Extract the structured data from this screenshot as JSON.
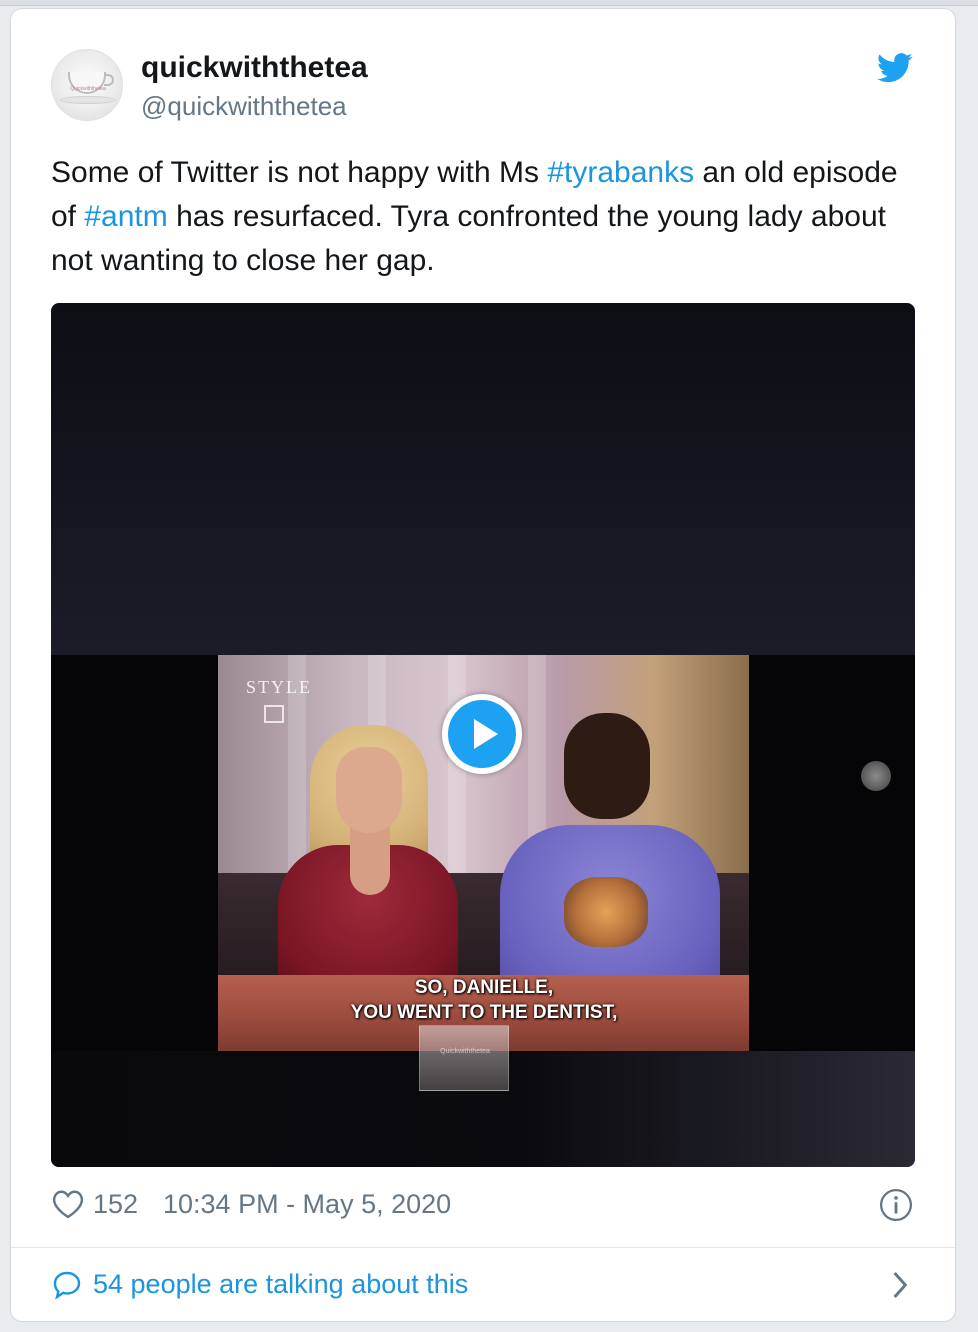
{
  "user": {
    "display_name": "quickwiththetea",
    "handle": "@quickwiththetea",
    "avatar_label": "Quickwiththetea"
  },
  "tweet": {
    "text_parts": [
      "Some of Twitter is not happy with Ms ",
      "#tyrabanks",
      " an old episode of ",
      "#antm",
      " has resurfaced. Tyra confronted the young lady about not wanting to close her gap."
    ]
  },
  "video": {
    "logo_text": "STYLE",
    "caption_line1": "SO, DANIELLE,",
    "caption_line2": "YOU WENT TO THE DENTIST,",
    "watermark_text": "Quickwiththetea"
  },
  "footer": {
    "like_count": "152",
    "timestamp": "10:34 PM - May 5, 2020"
  },
  "conversation": {
    "label": "54 people are talking about this"
  },
  "icons": {
    "brand": "twitter-bird-icon",
    "like": "heart-icon",
    "info": "info-icon",
    "reply": "speech-bubble-icon",
    "more": "chevron-right-icon",
    "play": "play-icon"
  },
  "colors": {
    "link": "#1b95e0",
    "brand": "#1da1f2",
    "text": "#14171a",
    "muted": "#657786"
  }
}
